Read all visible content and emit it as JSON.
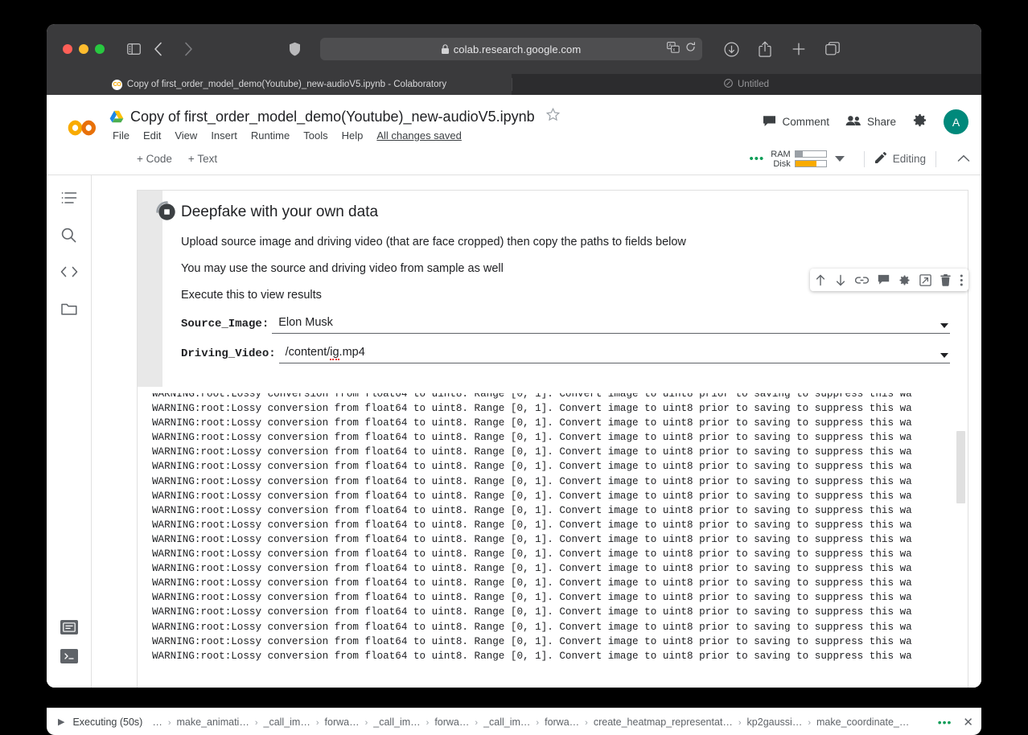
{
  "browser": {
    "url": "colab.research.google.com",
    "lock": "lock-icon",
    "tabs": [
      {
        "title": "Copy of first_order_model_demo(Youtube)_new-audioV5.ipynb - Colaboratory",
        "favicon": "CO",
        "active": true
      },
      {
        "title": "Untitled",
        "favicon": "compass-icon",
        "active": false
      }
    ]
  },
  "colab": {
    "doc_title": "Copy of first_order_model_demo(Youtube)_new-audioV5.ipynb",
    "menus": [
      "File",
      "Edit",
      "View",
      "Insert",
      "Runtime",
      "Tools",
      "Help"
    ],
    "save_status": "All changes saved",
    "header_actions": {
      "comment": "Comment",
      "share": "Share"
    },
    "avatar_letter": "A",
    "toolbar": {
      "add_code": "+ Code",
      "add_text": "+ Text",
      "ram_label": "RAM",
      "disk_label": "Disk",
      "ram_fill_pct": 25,
      "disk_fill_pct": 68,
      "ram_color": "#9aa0a6",
      "disk_color": "#f9ab00",
      "editing_label": "Editing"
    },
    "rail_items": [
      "toc-icon",
      "search-icon",
      "code-snippets-icon",
      "files-folder-icon"
    ],
    "rail_bottom_items": [
      "command-palette-icon",
      "terminal-icon"
    ],
    "cell_toolbar_icons": [
      "move-cell-up-icon",
      "move-cell-down-icon",
      "link-icon",
      "comment-icon",
      "settings-gear-icon",
      "mirror-cell-icon",
      "delete-cell-icon",
      "more-vert-icon"
    ]
  },
  "cell": {
    "run_state": "running",
    "heading": "Deepfake with your own data",
    "paragraphs": [
      "Upload source image and driving video (that are face cropped) then copy the paths to fields below",
      "You may use the source and driving video from sample as well",
      "Execute this to view results"
    ],
    "fields": [
      {
        "label": "Source_Image:",
        "value": "Elon Musk",
        "spell_error": ""
      },
      {
        "label": "Driving_Video:",
        "value": "/content/",
        "spell_error": "ig",
        "value_tail": ".mp4"
      }
    ]
  },
  "output": {
    "line": "WARNING:root:Lossy conversion from float64 to uint8. Range [0, 1]. Convert image to uint8 prior to saving to suppress this wa",
    "line_count": 19
  },
  "execbar": {
    "status": "Executing (50s)",
    "ellipsis": "…",
    "crumbs": [
      "make_animati…",
      "_call_im…",
      "forwa…",
      "_call_im…",
      "forwa…",
      "_call_im…",
      "forwa…",
      "create_heatmap_representat…",
      "kp2gaussi…",
      "make_coordinate_…"
    ],
    "more": "•••",
    "close": "✕"
  }
}
